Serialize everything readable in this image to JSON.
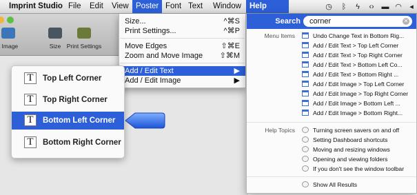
{
  "menubar": {
    "app_name": "Imprint Studio",
    "items": [
      "File",
      "Edit",
      "View",
      "Poster",
      "Font",
      "Text",
      "Window",
      "Help"
    ],
    "selected_color": "#2c5fd8",
    "status_icons": [
      "time-machine-icon",
      "bluetooth-icon",
      "power-icon",
      "sync-icon",
      "display-icon",
      "wifi-icon",
      "volume-icon"
    ]
  },
  "toolbar": {
    "buttons": [
      "t Image",
      "Size",
      "Print Settings"
    ]
  },
  "poster_menu": {
    "items": [
      {
        "label": "Size...",
        "shortcut": "^⌘S"
      },
      {
        "label": "Print Settings...",
        "shortcut": "^⌘P"
      },
      {
        "label": "Move Edges",
        "shortcut": "⇧⌘E"
      },
      {
        "label": "Zoom and Move Image",
        "shortcut": "⇧⌘M"
      },
      {
        "label": "Add / Edit Text",
        "shortcut": "▶"
      },
      {
        "label": "Add / Edit Image",
        "shortcut": "▶"
      }
    ]
  },
  "submenu": {
    "icon_glyph": "T",
    "items": [
      "Top Left Corner",
      "Top Right Corner",
      "Bottom Left Corner",
      "Bottom Right Corner"
    ],
    "selected_index": 2
  },
  "help": {
    "search_label": "Search",
    "search_value": "corner",
    "menu_items_label": "Menu Items",
    "menu_items": [
      "Undo Change Text in Bottom Rig...",
      "Add / Edit Text > Top Left Corner",
      "Add / Edit Text > Top Right Corner",
      "Add / Edit Text > Bottom Left Co...",
      "Add / Edit Text > Bottom Right ...",
      "Add / Edit Image > Top Left Corner",
      "Add / Edit Image > Top Right Corner",
      "Add / Edit Image > Bottom Left ...",
      "Add / Edit Image > Bottom Right..."
    ],
    "help_topics_label": "Help Topics",
    "help_topics": [
      "Turning screen savers on and off",
      "Setting Dashboard shortcuts",
      "Moving and resizing windows",
      "Opening and viewing folders",
      "If you don't see the window toolbar"
    ],
    "show_all": "Show All Results"
  }
}
